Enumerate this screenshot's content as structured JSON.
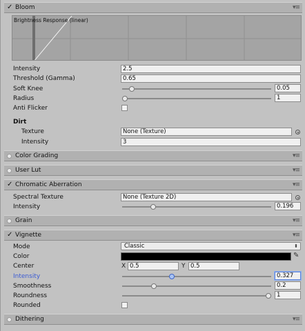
{
  "bloom": {
    "title": "Bloom",
    "graph_title": "Brightness Response (linear)",
    "intensity_label": "Intensity",
    "intensity_value": "2.5",
    "threshold_label": "Threshold (Gamma)",
    "threshold_value": "0.65",
    "soft_knee_label": "Soft Knee",
    "soft_knee_value": "0.05",
    "soft_knee_fraction": 0.05,
    "radius_label": "Radius",
    "radius_value": "1",
    "radius_fraction": 0.0,
    "anti_flicker_label": "Anti Flicker",
    "anti_flicker_checked": false,
    "dirt_heading": "Dirt",
    "dirt_texture_label": "Texture",
    "dirt_texture_value": "None (Texture)",
    "dirt_intensity_label": "Intensity",
    "dirt_intensity_value": "3"
  },
  "color_grading": {
    "title": "Color Grading",
    "enabled": false
  },
  "user_lut": {
    "title": "User Lut",
    "enabled": false
  },
  "chromatic_aberration": {
    "title": "Chromatic Aberration",
    "enabled": true,
    "spectral_texture_label": "Spectral Texture",
    "spectral_texture_value": "None (Texture 2D)",
    "intensity_label": "Intensity",
    "intensity_value": "0.196",
    "intensity_fraction": 0.196
  },
  "grain": {
    "title": "Grain",
    "enabled": false
  },
  "vignette": {
    "title": "Vignette",
    "enabled": true,
    "mode_label": "Mode",
    "mode_value": "Classic",
    "mode_arrow": "⬍",
    "color_label": "Color",
    "color_value": "#000000",
    "center_label": "Center",
    "center_x_label": "X",
    "center_x_value": "0.5",
    "center_y_label": "Y",
    "center_y_value": "0.5",
    "intensity_label": "Intensity",
    "intensity_value": "0.327",
    "intensity_fraction": 0.327,
    "smoothness_label": "Smoothness",
    "smoothness_value": "0.2",
    "smoothness_fraction": 0.2,
    "roundness_label": "Roundness",
    "roundness_value": "1",
    "roundness_fraction": 1.0,
    "rounded_label": "Rounded",
    "rounded_checked": false
  },
  "dithering": {
    "title": "Dithering",
    "enabled": false
  },
  "icons": {
    "check": "✓",
    "menu": "▾≡",
    "eyedropper": "✎"
  },
  "colors": {
    "header_bg": "#b1b1b1",
    "panel_bg": "#c2c2c2",
    "active_label": "#3b5bd4",
    "graph_bg": "#a4a4a4"
  }
}
